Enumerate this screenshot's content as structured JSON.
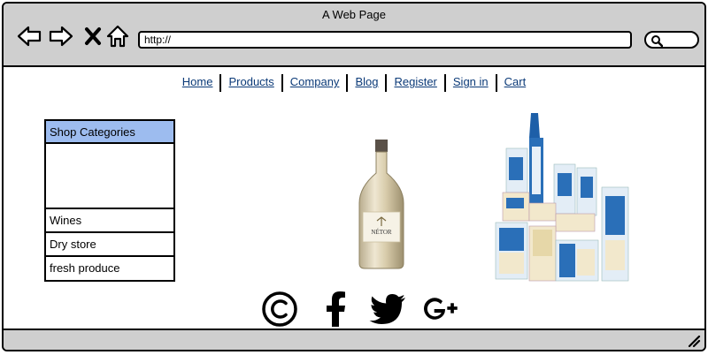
{
  "window": {
    "title": "A Web Page"
  },
  "browser": {
    "address_value": "http://",
    "icons": [
      "back-arrow-icon",
      "forward-arrow-icon",
      "close-x-icon",
      "home-icon",
      "search-icon"
    ]
  },
  "nav": {
    "items": [
      "Home",
      "Products",
      "Company",
      "Blog",
      "Register",
      "Sign in",
      "Cart"
    ]
  },
  "categories": {
    "header": "Shop Categories",
    "items": [
      "Wines",
      "Dry store",
      "fresh produce"
    ]
  },
  "products": {
    "wine_label": "NÉTOR"
  },
  "social": {
    "icons": [
      "copyright-icon",
      "facebook-icon",
      "twitter-icon",
      "google-plus-icon"
    ]
  },
  "colors": {
    "chrome": "#cfcfcf",
    "link": "#0b3a78",
    "category_header": "#9dbcef"
  }
}
